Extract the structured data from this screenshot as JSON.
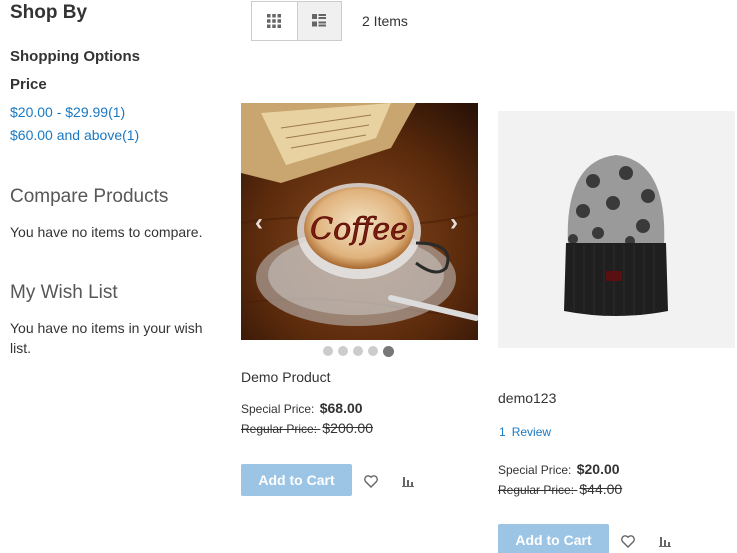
{
  "sidebar": {
    "title": "Shop By",
    "shopping_options": "Shopping Options",
    "price_title": "Price",
    "filters": [
      {
        "label": "$20.00 - $29.99",
        "count": "(1)"
      },
      {
        "label": "$60.00 and above",
        "count": "(1)"
      }
    ],
    "compare": {
      "title": "Compare Products",
      "empty_text": "You have no items to compare."
    },
    "wishlist": {
      "title": "My Wish List",
      "empty_text": "You have no items in your wish list."
    }
  },
  "toolbar": {
    "items_count": "2 Items",
    "view_modes": [
      "grid",
      "list"
    ],
    "active_mode": "grid"
  },
  "products": [
    {
      "name": "Demo Product",
      "image_icon": "coffee-cup-image",
      "gallery_dots": 5,
      "active_dot": 5,
      "special_price_label": "Special Price:",
      "special_price": "$68.00",
      "regular_price_label": "Regular Price:",
      "regular_price": "$200.00",
      "add_to_cart": "Add to Cart"
    },
    {
      "name": "demo123",
      "image_icon": "beanie-hat-image",
      "reviews_count": "1",
      "reviews_label": "Review",
      "special_price_label": "Special Price:",
      "special_price": "$20.00",
      "regular_price_label": "Regular Price:",
      "regular_price": "$44.00",
      "add_to_cart": "Add to Cart"
    }
  ],
  "colors": {
    "link": "#1979c3",
    "button_bg": "#9cc4e4",
    "button_text": "#ffffff",
    "text": "#333333",
    "block_title": "#575757"
  }
}
